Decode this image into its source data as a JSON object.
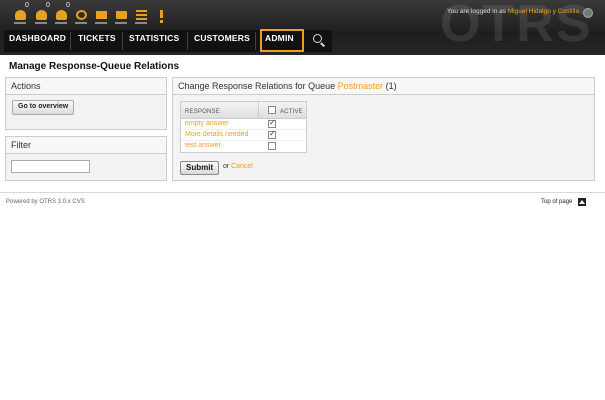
{
  "header": {
    "watermark": "OTRS",
    "login_prefix": "You are logged in as",
    "user_name": "Miguel Hidalgo y Costilla",
    "toolbar": [
      {
        "icon": "locked-tickets-icon",
        "badge": "0"
      },
      {
        "icon": "watched-tickets-icon",
        "badge": "0"
      },
      {
        "icon": "responsible-tickets-icon",
        "badge": "0"
      },
      {
        "icon": "phone-ticket-icon",
        "badge": ""
      },
      {
        "icon": "email-ticket-icon",
        "badge": ""
      },
      {
        "icon": "queue-view-icon",
        "badge": ""
      },
      {
        "icon": "status-view-icon",
        "badge": ""
      },
      {
        "icon": "escalation-view-icon",
        "badge": ""
      }
    ],
    "nav": [
      "DASHBOARD",
      "TICKETS",
      "STATISTICS",
      "CUSTOMERS",
      "ADMIN"
    ],
    "colors": {
      "accent": "#f0a020",
      "header_bg": "#262626"
    }
  },
  "page_title": "Manage Response-Queue Relations",
  "actions": {
    "title": "Actions",
    "overview_button": "Go to overview"
  },
  "filter": {
    "title": "Filter",
    "value": ""
  },
  "main": {
    "title_prefix": "Change Response Relations for Queue",
    "queue": "Postmaster",
    "count": "(1)",
    "col_response": "RESPONSE",
    "col_active": "ACTIVE",
    "rows": [
      {
        "name": "empty answer",
        "active": true
      },
      {
        "name": "More details needed",
        "active": true
      },
      {
        "name": "test answer",
        "active": false
      }
    ],
    "submit_label": "Submit",
    "or_label": "or",
    "cancel_label": "Cancel"
  },
  "footer": {
    "powered_by": "Powered by OTRS 3.0.x CVS",
    "top_of_page": "Top of page"
  }
}
